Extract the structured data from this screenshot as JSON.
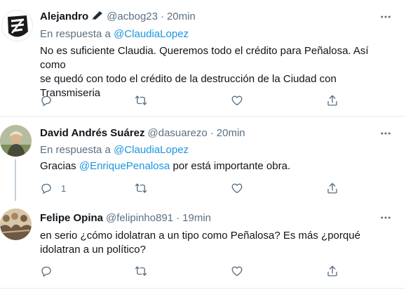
{
  "tweets": [
    {
      "name": "Alejandro",
      "handle": "@acbog23",
      "time": "20min",
      "reply_prefix": "En respuesta a",
      "reply_to": "@ClaudiaLopez",
      "text_lines": [
        "No es suficiente Claudia. Queremos todo el crédito para Peñalosa. Así como",
        "se quedó con todo el crédito de la destrucción de la Ciudad con",
        "Transmiseria"
      ],
      "reply_count": ""
    },
    {
      "name": "David Andrés Suárez",
      "handle": "@dasuarezo",
      "time": "20min",
      "reply_prefix": "En respuesta a",
      "reply_to": "@ClaudiaLopez",
      "text_before": "Gracias",
      "mention": "@EnriquePenalosa",
      "text_after": "por está importante obra.",
      "reply_count": "1"
    },
    {
      "name": "Felipe Opina",
      "handle": "@felipinho891",
      "time": "19min",
      "text_lines": [
        "en serio ¿cómo idolatran a un tipo como Peñalosa? Es más ¿porqué",
        "idolatran a un político?"
      ],
      "reply_count": ""
    }
  ],
  "dot": "·",
  "icons": [
    "more-icon",
    "reply-icon",
    "retweet-icon",
    "like-icon",
    "share-icon",
    "pen-badge-icon"
  ],
  "colors": {
    "link": "#1b95e0",
    "muted": "#5b7083",
    "text": "#0f1419",
    "divider": "#e6ecf0"
  }
}
